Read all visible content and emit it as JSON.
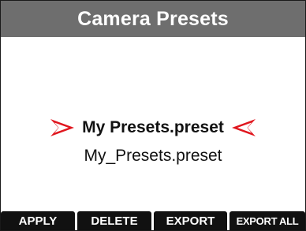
{
  "header": {
    "title": "Camera Presets"
  },
  "presets": {
    "selected_label": "My Presets.preset",
    "items": [
      "My_Presets.preset"
    ],
    "arrow_color": "#e0161e"
  },
  "softkeys": {
    "apply": "APPLY",
    "delete": "DELETE",
    "export": "EXPORT",
    "export_all": "EXPORT ALL"
  },
  "theme": {
    "title_bar_color": "#6e6e6e",
    "softkey_color": "#111111"
  },
  "icons": {
    "left_arrow": "selection-arrow-right-icon",
    "right_arrow": "selection-arrow-left-icon"
  }
}
